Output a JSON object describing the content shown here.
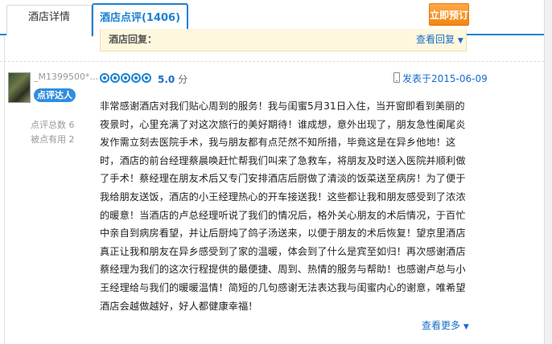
{
  "tabs": {
    "detail": "酒店详情",
    "reviews": "酒店点评(1406)"
  },
  "book_button": "立即预订",
  "hotel_reply": {
    "label": "酒店回复：",
    "view_reply": "查看回复",
    "chevron": "▼"
  },
  "review": {
    "user": {
      "name": "_M1399500*...",
      "badge": "点评达人",
      "reviews_total_label": "点评总数 6",
      "helpful_label": "被点有用 2"
    },
    "rating": {
      "dots": 5,
      "score": "5.0",
      "unit": "分"
    },
    "posted": "发表于2015-06-09",
    "text": "非常感谢酒店对我们贴心周到的服务！我与闺蜜5月31日入住，当开窗即看到美丽的夜景时，心里充满了对这次旅行的美好期待！谁成想，意外出现了，朋友急性阑尾炎发作需立刻去医院手术，我与朋友都有点茫然不知所措，毕竟这是在异乡他地！这时，酒店的前台经理蔡晨唤赶忙帮我们叫来了急救车，将朋友及时送入医院并顺利做了手术！蔡经理在朋友术后又专门安排酒店后厨做了清淡的饭菜送至病房！为了便于我给朋友送饭，酒店的小王经理热心的开车接送我！这些都让我和朋友感受到了浓浓的暖意！当酒店的卢总经理听说了我们的情况后，格外关心朋友的术后情况，于百忙中亲自到病房看望，并让后厨炖了鸽子汤送来，以便于朋友的术后恢复！望京里酒店真正让我和朋友在异乡感受到了家的温暖，体会到了什么是宾至如归！再次感谢酒店蔡经理为我们的这次行程提供的最便捷、周到、热情的服务与帮助！也感谢卢总与小王经理给与我们的暖暖温情！简短的几句感谢无法表达我与闺蜜内心的谢意，唯希望酒店会越做越好，好人都健康幸福！",
    "see_more": "查看更多",
    "chevron": "▼"
  }
}
